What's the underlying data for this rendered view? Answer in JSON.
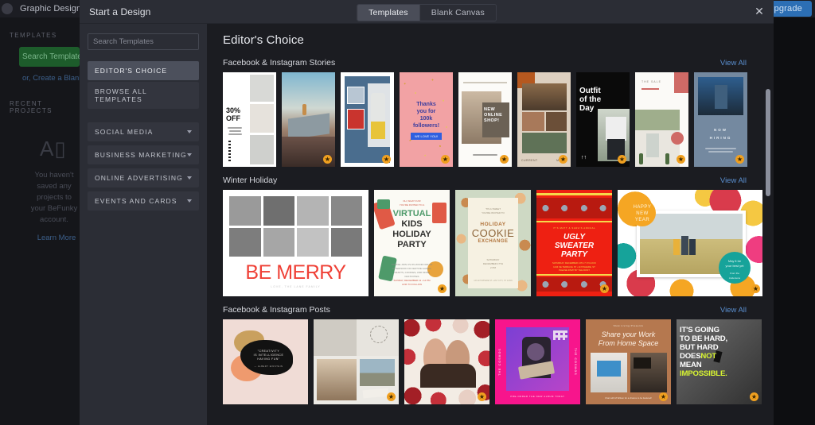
{
  "background_app": {
    "mode_label": "Graphic Designer",
    "upgrade_label": "Upgrade",
    "templates_header": "TEMPLATES",
    "search_templates_button": "Search Templates",
    "blank_canvas_link": "or, Create a Blank Canvas",
    "recent_projects_header": "RECENT PROJECTS",
    "empty_state_text": "You haven't saved any projects to your BeFunky account.",
    "learn_more_link": "Learn More"
  },
  "modal": {
    "title": "Start a Design",
    "close_icon": "close-icon",
    "tabs": [
      {
        "label": "Templates",
        "active": true
      },
      {
        "label": "Blank Canvas",
        "active": false
      }
    ],
    "search": {
      "placeholder": "Search Templates",
      "value": "",
      "button_icon": "search-icon"
    },
    "nav": {
      "primary": [
        {
          "label": "EDITOR'S CHOICE",
          "active": true
        },
        {
          "label": "BROWSE ALL TEMPLATES",
          "active": false
        }
      ],
      "categories": [
        {
          "label": "SOCIAL MEDIA",
          "expanded": false
        },
        {
          "label": "BUSINESS MARKETING",
          "expanded": false
        },
        {
          "label": "ONLINE ADVERTISING",
          "expanded": false
        },
        {
          "label": "EVENTS AND CARDS",
          "expanded": false
        }
      ]
    },
    "content": {
      "heading": "Editor's Choice",
      "view_all_label": "View All",
      "sections": [
        {
          "title": "Facebook & Instagram Stories",
          "kind": "story",
          "items": [
            {
              "name": "30% off fashion sale story",
              "pro": false
            },
            {
              "name": "cliff sunset adventure story",
              "pro": true
            },
            {
              "name": "street style collage story",
              "pro": true
            },
            {
              "name": "thanks for 100k followers story",
              "pro": true
            },
            {
              "name": "new online shop story",
              "pro": true
            },
            {
              "name": "current mood pottery story",
              "pro": true
            },
            {
              "name": "outfit of the day story",
              "pro": true
            },
            {
              "name": "the sale desert house story",
              "pro": true
            },
            {
              "name": "now hiring story",
              "pro": true
            }
          ]
        },
        {
          "title": "Winter Holiday",
          "kind": "holiday",
          "items": [
            {
              "name": "be merry photo grid",
              "pro": false,
              "wide": true
            },
            {
              "name": "virtual kids holiday party",
              "pro": true
            },
            {
              "name": "holiday cookie exchange",
              "pro": false
            },
            {
              "name": "ugly sweater party",
              "pro": true
            },
            {
              "name": "happy new year photo card",
              "pro": true,
              "wide": true
            }
          ]
        },
        {
          "title": "Facebook & Instagram Posts",
          "kind": "post",
          "items": [
            {
              "name": "creativity is intelligence having fun",
              "pro": false
            },
            {
              "name": "travel postcard collage",
              "pro": true
            },
            {
              "name": "floral couple frame",
              "pro": true
            },
            {
              "name": "the cosmos album promo",
              "pro": false
            },
            {
              "name": "share your work from home space",
              "pro": true
            },
            {
              "name": "it's going to be hard quote",
              "pro": true
            }
          ]
        }
      ]
    }
  },
  "thumb_texts": {
    "s1_pct": "30%",
    "s1_off": "OFF",
    "s4_l1": "Thanks",
    "s4_l2": "you for",
    "s4_l3": "100k",
    "s4_l4": "followers!",
    "s4_btn": "WE LOVE YOU!",
    "s5_l1": "NEW",
    "s5_l2": "ONLINE",
    "s5_l3": "SHOP!",
    "s6_left": "CURRENT",
    "s6_right": "MOOD",
    "s7_l1": "Outfit",
    "s7_l2": "of the",
    "s7_l3": "Day",
    "s8_l1": "THE SALE",
    "s9_l1": "NOW",
    "s9_l2": "HIRING",
    "h1_title": "BE MERRY",
    "h2_l1": "VIRTUAL",
    "h2_l2": "KIDS",
    "h2_l3": "HOLIDAY",
    "h2_l4": "PARTY",
    "h3_l1": "HOLIDAY",
    "h3_l2": "COOKIE",
    "h3_l3": "EXCHANGE",
    "h4_l1": "UGLY",
    "h4_l2": "SWEATER",
    "h4_l3": "PARTY",
    "h5_l1": "HAPPY",
    "h5_l2": "NEW",
    "h5_l3": "YEAR",
    "h5_c1": "May it be",
    "h5_c2": "your best yet",
    "h5_c3": "From the",
    "h5_c4": "Andersons",
    "p1_l1": "\"CREATIVITY",
    "p1_l2": "IS INTELLIGENCE",
    "p1_l3": "HAVING FUN\"",
    "p4_left": "THE COSMOS",
    "p4_right": "THE COSMOS",
    "p5_l1": "Share your Work",
    "p5_l2": "From Home Space",
    "p6_l1": "IT'S GOING",
    "p6_l2": "TO BE HARD,",
    "p6_l3": "BUT HARD",
    "p6_l4a": "DOES",
    "p6_l4b": "NOT",
    "p6_l5": "MEAN",
    "p6_l6": "IMPOSSIBLE.",
    "pro_badge_icon": "star-badge-icon"
  },
  "colors": {
    "modal_bg": "#2b2d35",
    "content_bg": "#1b1c21",
    "accent_blue": "#3d8bd8",
    "link_blue": "#5a8fd0",
    "pro_gold": "#f0a020",
    "upgrade_blue": "#2c6fb5",
    "nav_active": "#4c505c"
  }
}
